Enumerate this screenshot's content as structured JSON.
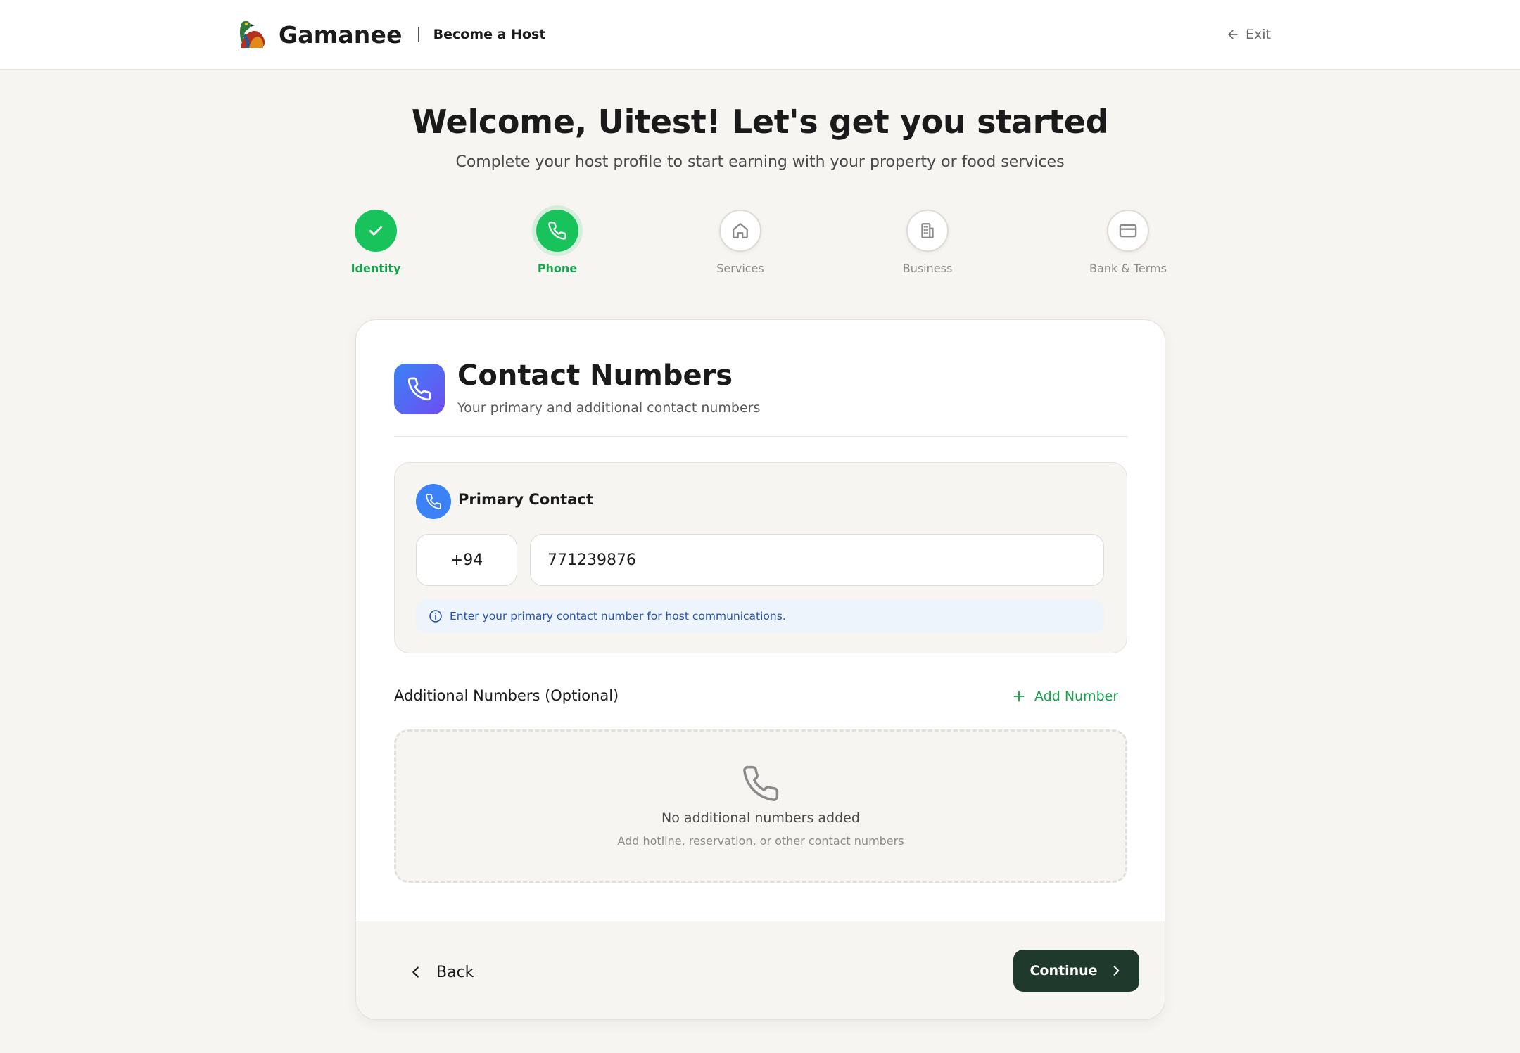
{
  "header": {
    "brand_name": "Gamanee",
    "brand_subtitle": "Become a Host",
    "exit_label": "Exit"
  },
  "hero": {
    "title": "Welcome, Uitest! Let's get you started",
    "subtitle": "Complete your host profile to start earning with your property or food services"
  },
  "steps": [
    {
      "label": "Identity",
      "state": "done",
      "icon": "check-icon"
    },
    {
      "label": "Phone",
      "state": "active",
      "icon": "phone-icon"
    },
    {
      "label": "Services",
      "state": "pending",
      "icon": "home-icon"
    },
    {
      "label": "Business",
      "state": "pending",
      "icon": "building-icon"
    },
    {
      "label": "Bank & Terms",
      "state": "pending",
      "icon": "credit-card-icon"
    }
  ],
  "card": {
    "title": "Contact Numbers",
    "subtitle": "Your primary and additional contact numbers",
    "primary": {
      "label": "Primary Contact",
      "country_code": "+94",
      "phone_value": "771239876",
      "hint": "Enter your primary contact number for host communications."
    },
    "additional": {
      "label": "Additional Numbers (Optional)",
      "add_label": "Add Number",
      "empty_title": "No additional numbers added",
      "empty_subtitle": "Add hotline, reservation, or other contact numbers"
    },
    "footer": {
      "back_label": "Back",
      "continue_label": "Continue"
    }
  },
  "colors": {
    "accent_green": "#17c35a",
    "text_green": "#16a34a",
    "primary_blue": "#3b82f6",
    "gradient_purple": "#6d4ef0",
    "continue_bg": "#1f3a2c",
    "page_bg": "#f7f5f2"
  }
}
